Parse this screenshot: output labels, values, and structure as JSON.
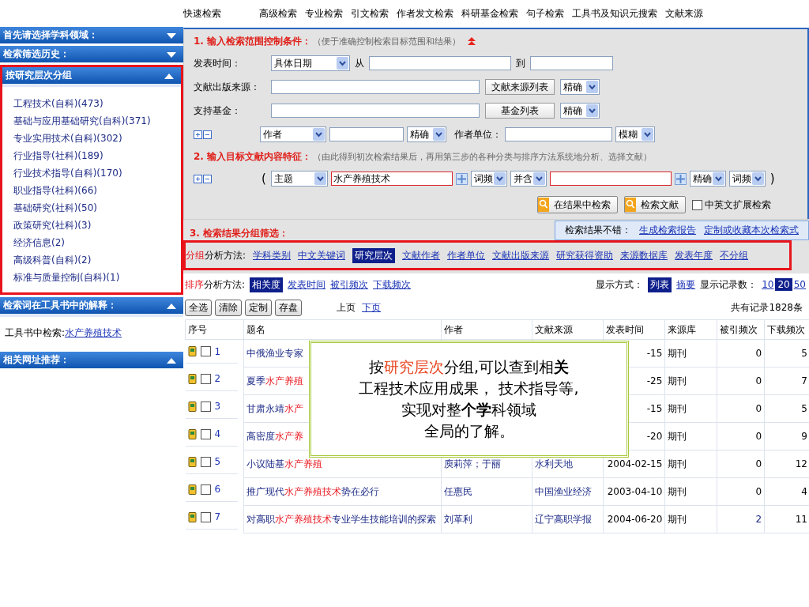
{
  "top_nav": [
    "快速检索",
    "高级检索",
    "专业检索",
    "引文检索",
    "作者发文检索",
    "科研基金检索",
    "句子检索",
    "工具书及知识元搜索",
    "文献来源"
  ],
  "sidebar": {
    "panels": [
      {
        "title": "首先请选择学科领域：",
        "expanded": false,
        "highlighted": false
      },
      {
        "title": "检索筛选历史：",
        "expanded": false,
        "highlighted": false
      },
      {
        "title": "按研究层次分组",
        "expanded": true,
        "highlighted": true,
        "items": [
          "工程技术(自科)(473)",
          "基础与应用基础研究(自科)(371)",
          "专业实用技术(自科)(302)",
          "行业指导(社科)(189)",
          "行业技术指导(自科)(170)",
          "职业指导(社科)(66)",
          "基础研究(社科)(50)",
          "政策研究(社科)(3)",
          "经济信息(2)",
          "高级科普(自科)(2)",
          "标准与质量控制(自科)(1)"
        ]
      },
      {
        "title": "检索词在工具书中的解释：",
        "expanded": true,
        "highlighted": false,
        "lookup": {
          "label": "工具书中检索:",
          "link": "水产养殖技术"
        }
      },
      {
        "title": "相关网址推荐：",
        "expanded": true,
        "highlighted": false
      }
    ]
  },
  "step1": {
    "title": "1. 输入检索范围控制条件：",
    "hint": "（便于准确控制检索目标范围和结果）"
  },
  "date_row": {
    "label": "发表时间：",
    "mode": "具体日期",
    "from_label": "从",
    "to_label": "到"
  },
  "source_row": {
    "label": "文献出版来源：",
    "button": "文献来源列表",
    "match": "精确"
  },
  "fund_row": {
    "label": "支持基金：",
    "button": "基金列表",
    "match": "精确"
  },
  "author_row": {
    "field": "作者",
    "match": "精确",
    "unit_label": "作者单位：",
    "unit_match": "模糊"
  },
  "step2": {
    "title": "2. 输入目标文献内容特征：",
    "hint": "（由此得到初次检索结果后，再用第三步的各种分类与排序方法系统地分析、选择文献）"
  },
  "content_row": {
    "open_paren": "(",
    "field": "主题",
    "value": "水产养殖技术",
    "freq1": "词频",
    "logic": "并含",
    "match": "精确",
    "freq2": "词频",
    "close_paren": ")"
  },
  "actions": {
    "buttons": [
      "在结果中检索",
      "检索文献"
    ],
    "extend": {
      "label": "中英文扩展检索",
      "checked": false
    }
  },
  "step3": {
    "title": "3. 检索结果分组筛选：",
    "notice": "检索结果不错：",
    "links": [
      "生成检索报告",
      "定制或收藏本次检索式"
    ]
  },
  "grouping": {
    "prefix": "分组",
    "label": "分析方法:",
    "highlighted": true,
    "options": [
      {
        "label": "学科类别",
        "selected": false
      },
      {
        "label": "中文关键词",
        "selected": false
      },
      {
        "label": "研究层次",
        "selected": true
      },
      {
        "label": "文献作者",
        "selected": false
      },
      {
        "label": "作者单位",
        "selected": false
      },
      {
        "label": "文献出版来源",
        "selected": false
      },
      {
        "label": "研究获得资助",
        "selected": false
      },
      {
        "label": "来源数据库",
        "selected": false
      },
      {
        "label": "发表年度",
        "selected": false
      },
      {
        "label": "不分组",
        "selected": false
      }
    ]
  },
  "sorting": {
    "prefix": "排序",
    "label": "分析方法:",
    "options": [
      {
        "label": "相关度",
        "selected": true
      },
      {
        "label": "发表时间",
        "selected": false
      },
      {
        "label": "被引频次",
        "selected": false
      },
      {
        "label": "下载频次",
        "selected": false
      }
    ]
  },
  "display": {
    "label": "显示方式：",
    "modes": [
      {
        "label": "列表",
        "selected": true
      },
      {
        "label": "摘要",
        "selected": false
      }
    ],
    "count_label": "显示记录数：",
    "counts": [
      {
        "label": "10",
        "selected": false
      },
      {
        "label": "20",
        "selected": true
      },
      {
        "label": "50",
        "selected": false
      }
    ]
  },
  "toolbar": {
    "buttons": [
      "全选",
      "清除",
      "定制",
      "存盘"
    ],
    "prev": "上页",
    "next": "下页",
    "total": "共有记录1828条"
  },
  "table": {
    "columns": [
      "序号",
      "题名",
      "作者",
      "文献来源",
      "发表时间",
      "来源库",
      "被引频次",
      "下载频次"
    ],
    "rows": [
      {
        "number": "1",
        "checked": false,
        "title": [
          {
            "text": "中俄渔业专家",
            "hit": false
          }
        ],
        "date": "-15",
        "db": "期刊",
        "cited": "0",
        "cited_linked": false,
        "downloads": "5"
      },
      {
        "number": "2",
        "checked": false,
        "title": [
          {
            "text": "夏季",
            "hit": false
          },
          {
            "text": "水产养殖",
            "hit": true
          }
        ],
        "date": "-25",
        "db": "期刊",
        "cited": "0",
        "cited_linked": false,
        "downloads": "7"
      },
      {
        "number": "3",
        "checked": false,
        "title": [
          {
            "text": "甘肃永靖",
            "hit": false
          },
          {
            "text": "水产",
            "hit": true
          }
        ],
        "date": "-15",
        "db": "期刊",
        "cited": "0",
        "cited_linked": false,
        "downloads": "5"
      },
      {
        "number": "4",
        "checked": false,
        "title": [
          {
            "text": "高密度",
            "hit": false
          },
          {
            "text": "水产养",
            "hit": true
          }
        ],
        "date": "-20",
        "db": "期刊",
        "cited": "0",
        "cited_linked": false,
        "downloads": "9"
      },
      {
        "number": "5",
        "checked": false,
        "title": [
          {
            "text": "小议陆基",
            "hit": false
          },
          {
            "text": "水产养殖",
            "hit": true
          }
        ],
        "author": "庾莉萍；于丽",
        "source": "水利天地",
        "date": "2004-02-15",
        "db": "期刊",
        "cited": "0",
        "cited_linked": false,
        "downloads": "12"
      },
      {
        "number": "6",
        "checked": false,
        "title": [
          {
            "text": "推广现代",
            "hit": false
          },
          {
            "text": "水产养殖技术",
            "hit": true
          },
          {
            "text": "势在必行",
            "hit": false
          }
        ],
        "author": "任惠民",
        "source": "中国渔业经济",
        "date": "2003-04-10",
        "db": "期刊",
        "cited": "0",
        "cited_linked": false,
        "downloads": "4"
      },
      {
        "number": "7",
        "checked": false,
        "title": [
          {
            "text": "对高职",
            "hit": false
          },
          {
            "text": "水产养殖技术",
            "hit": true
          },
          {
            "text": "专业学生技能培训的探索",
            "hit": false
          }
        ],
        "author": "刘革利",
        "source": "辽宁高职学报",
        "date": "2004-06-20",
        "db": "期刊",
        "cited": "2",
        "cited_linked": true,
        "downloads": "11"
      }
    ]
  },
  "callout": {
    "lines": [
      [
        {
          "text": "按",
          "red": false
        },
        {
          "text": "研究层次",
          "red": true
        },
        {
          "text": "分组,可以查到相**关**",
          "red": false
        }
      ],
      [
        {
          "text": "工程技术应用成果， 技术指导等,",
          "red": false
        }
      ],
      [
        {
          "text": "实现对整**个学**科领域",
          "red": false
        }
      ],
      [
        {
          "text": "全局的了解。",
          "red": false
        }
      ]
    ]
  }
}
